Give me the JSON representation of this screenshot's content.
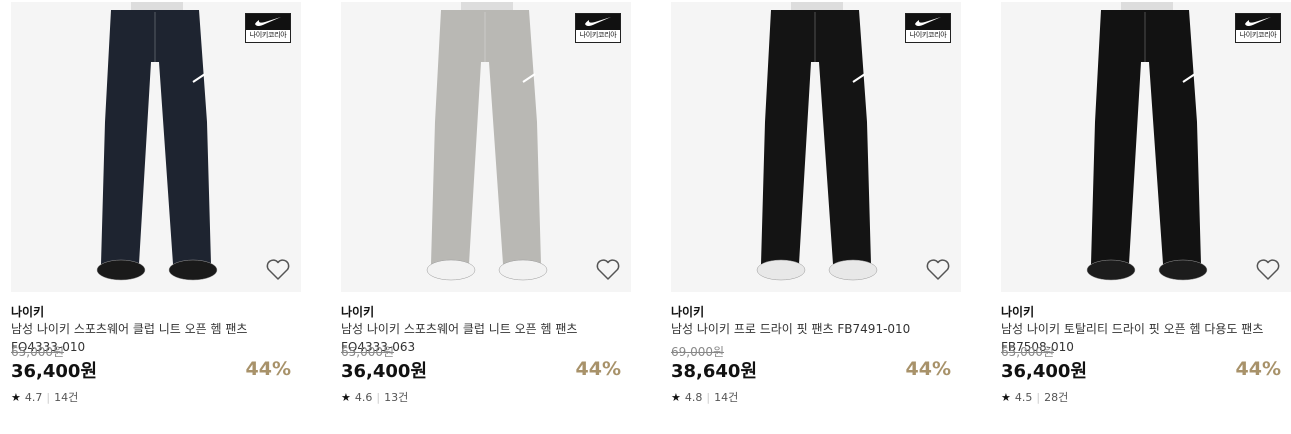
{
  "products": [
    {
      "brand": "나이키",
      "name": "남성 나이키 스포츠웨어 클럽 니트 오픈 헴 팬츠 FQ4333-010",
      "original_price": "65,000원",
      "price": "36,400원",
      "discount": "44%",
      "rating": "4.7",
      "reviews": "14건",
      "badge_label": "나이키코리아",
      "pants_color": "#1e2430",
      "shoe_color": "#1a1a1a"
    },
    {
      "brand": "나이키",
      "name": "남성 나이키 스포츠웨어 클럽 니트 오픈 헴 팬츠 FQ4333-063",
      "original_price": "65,000원",
      "price": "36,400원",
      "discount": "44%",
      "rating": "4.6",
      "reviews": "13건",
      "badge_label": "나이키코리아",
      "pants_color": "#b9b8b4",
      "shoe_color": "#f2f2f2"
    },
    {
      "brand": "나이키",
      "name": "남성 나이키 프로 드라이 핏 팬츠 FB7491-010",
      "original_price": "69,000원",
      "price": "38,640원",
      "discount": "44%",
      "rating": "4.8",
      "reviews": "14건",
      "badge_label": "나이키코리아",
      "pants_color": "#141414",
      "shoe_color": "#e8e8e8"
    },
    {
      "brand": "나이키",
      "name": "남성 나이키 토탈리티 드라이 핏 오픈 헴 다용도 팬츠 FB7508-010",
      "original_price": "65,000원",
      "price": "36,400원",
      "discount": "44%",
      "rating": "4.5",
      "reviews": "28건",
      "badge_label": "나이키코리아",
      "pants_color": "#121212",
      "shoe_color": "#1c1c1c"
    }
  ],
  "colors": {
    "discount": "#a8926a"
  },
  "icons": {
    "wishlist": "heart-outline-icon",
    "rating": "star-icon",
    "brand": "swoosh-icon"
  }
}
